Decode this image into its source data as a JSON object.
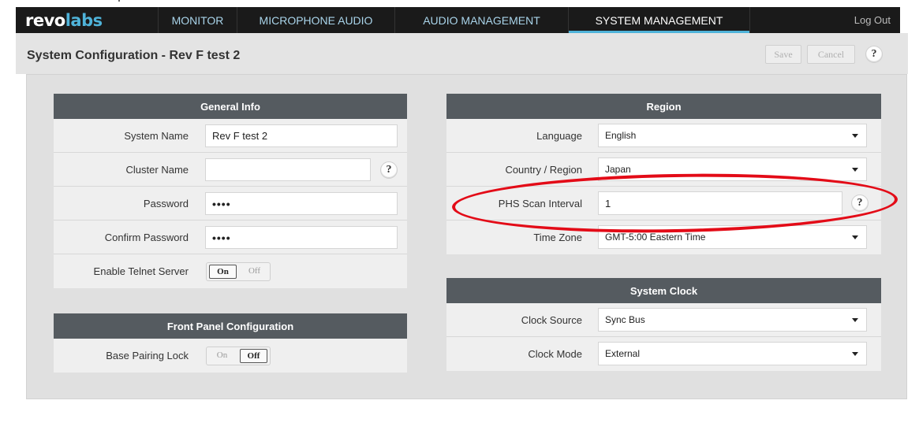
{
  "app": {
    "logo_part1": "revo",
    "logo_part2": "labs",
    "accent_color": "#4fb3d9",
    "annotation_color": "#e30b17"
  },
  "nav": {
    "tabs": [
      {
        "label": "MONITOR"
      },
      {
        "label": "MICROPHONE AUDIO"
      },
      {
        "label": "AUDIO MANAGEMENT"
      },
      {
        "label": "SYSTEM MANAGEMENT"
      }
    ],
    "active_tab": "SYSTEM MANAGEMENT",
    "logout_label": "Log Out"
  },
  "header": {
    "title": "System Configuration - Rev F test 2",
    "save_label": "Save",
    "cancel_label": "Cancel",
    "help_label": "?"
  },
  "general_info": {
    "title": "General Info",
    "system_name_label": "System Name",
    "system_name_value": "Rev F test 2",
    "cluster_name_label": "Cluster Name",
    "cluster_name_value": "",
    "cluster_help": "?",
    "password_label": "Password",
    "password_value": "••••",
    "confirm_password_label": "Confirm Password",
    "confirm_password_value": "••••",
    "telnet_label": "Enable Telnet Server",
    "telnet_on": "On",
    "telnet_off": "Off",
    "telnet_state": "On"
  },
  "front_panel": {
    "title": "Front Panel Configuration",
    "pairing_label": "Base Pairing Lock",
    "pairing_on": "On",
    "pairing_off": "Off",
    "pairing_state": "Off"
  },
  "region": {
    "title": "Region",
    "language_label": "Language",
    "language_value": "English",
    "country_label": "Country / Region",
    "country_value": "Japan",
    "phs_label": "PHS Scan Interval",
    "phs_value": "1",
    "phs_help": "?",
    "timezone_label": "Time Zone",
    "timezone_value": "GMT-5:00 Eastern Time"
  },
  "system_clock": {
    "title": "System Clock",
    "source_label": "Clock Source",
    "source_value": "Sync Bus",
    "mode_label": "Clock Mode",
    "mode_value": "External"
  }
}
